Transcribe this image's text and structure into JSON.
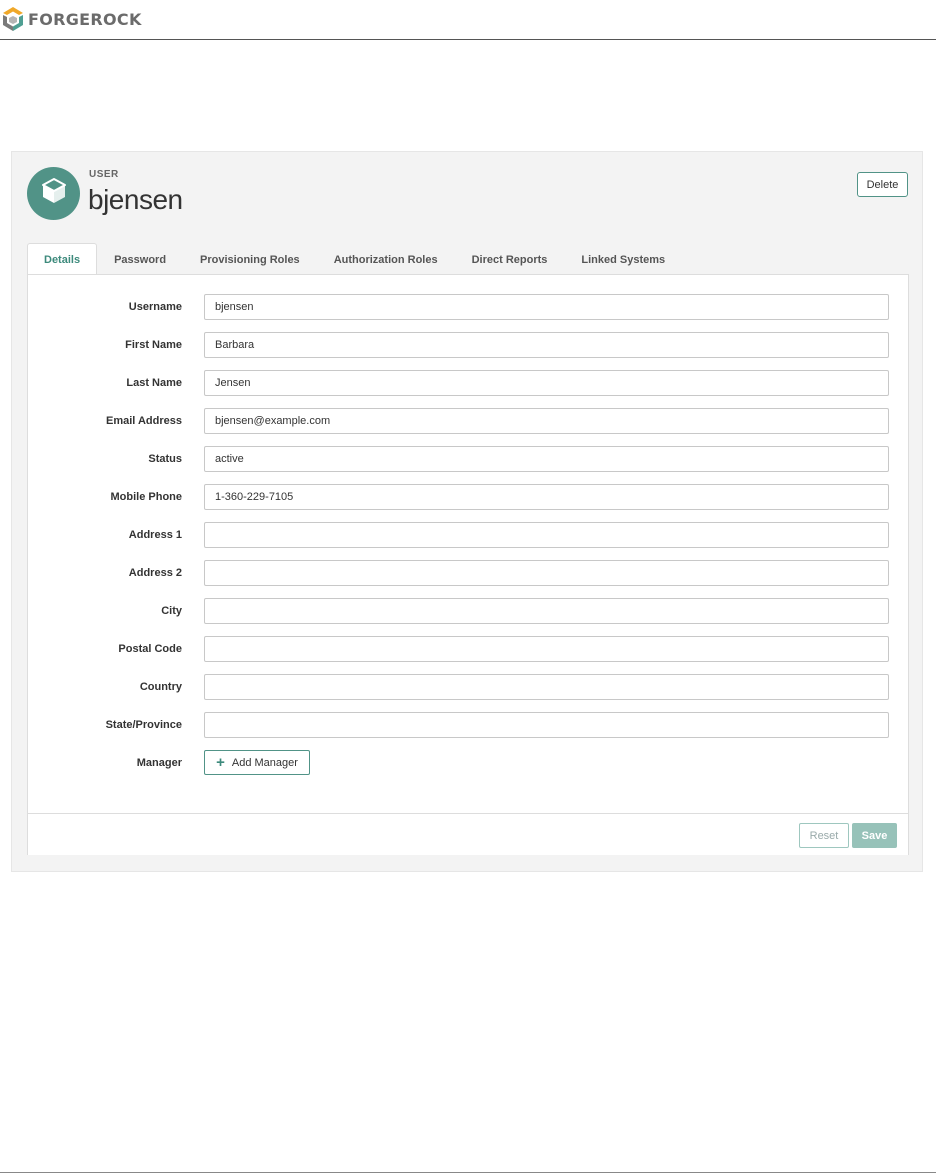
{
  "brand": {
    "name": "FORGEROCK",
    "icon": "forgerock-logo-icon",
    "accent": "#519387"
  },
  "header": {
    "kind": "USER",
    "username": "bjensen",
    "avatar_icon": "cube-icon",
    "delete_label": "Delete"
  },
  "tabs": [
    {
      "label": "Details",
      "active": true
    },
    {
      "label": "Password"
    },
    {
      "label": "Provisioning Roles"
    },
    {
      "label": "Authorization Roles"
    },
    {
      "label": "Direct Reports"
    },
    {
      "label": "Linked Systems"
    }
  ],
  "form": {
    "fields": [
      {
        "label": "Username",
        "value": "bjensen"
      },
      {
        "label": "First Name",
        "value": "Barbara"
      },
      {
        "label": "Last Name",
        "value": "Jensen"
      },
      {
        "label": "Email Address",
        "value": "bjensen@example.com"
      },
      {
        "label": "Status",
        "value": "active"
      },
      {
        "label": "Mobile Phone",
        "value": "1-360-229-7105"
      },
      {
        "label": "Address 1",
        "value": ""
      },
      {
        "label": "Address 2",
        "value": ""
      },
      {
        "label": "City",
        "value": ""
      },
      {
        "label": "Postal Code",
        "value": ""
      },
      {
        "label": "Country",
        "value": ""
      },
      {
        "label": "State/Province",
        "value": ""
      }
    ],
    "manager_label": "Manager",
    "add_manager_label": "Add Manager",
    "add_icon": "plus-icon"
  },
  "footer": {
    "reset_label": "Reset",
    "save_label": "Save"
  }
}
